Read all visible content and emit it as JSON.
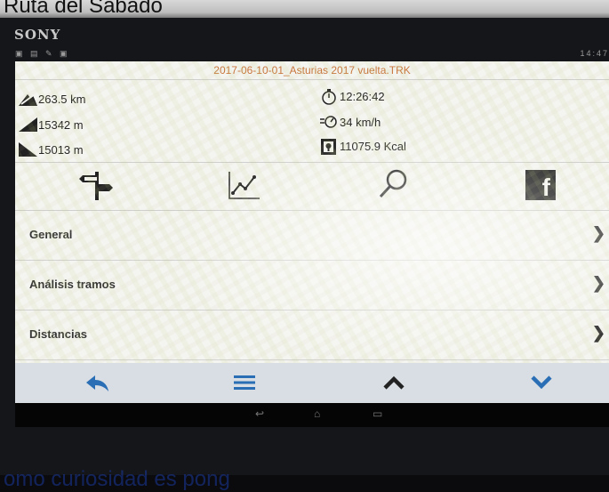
{
  "banner": {
    "text": "Ruta del Sábado"
  },
  "device": {
    "brand": "SONY"
  },
  "statusbar": {
    "left_icons": "▣ ▤ ✎ ▣",
    "right_text": "14:47"
  },
  "app": {
    "file_title": "2017-06-10-01_Asturias 2017 vuelta.TRK",
    "stats": {
      "distance": "263.5 km",
      "ascent": "15342 m",
      "descent": "15013 m",
      "time": "12:26:42",
      "speed": "34 km/h",
      "energy": "11075.9 Kcal"
    },
    "toolbar_icons": [
      "signpost-icon",
      "chart-icon",
      "search-icon",
      "facebook-icon"
    ],
    "facebook_glyph": "f",
    "menu": [
      {
        "label": "General",
        "chevron": "❯"
      },
      {
        "label": "Análisis tramos",
        "chevron": "❯"
      },
      {
        "label": "Distancias",
        "chevron": "❯"
      }
    ],
    "bottom_bar": [
      "back-icon",
      "menu-icon",
      "up-icon",
      "down-icon"
    ],
    "accent": "#2a6fb5",
    "title_color": "#c8743a"
  },
  "system_nav": {
    "back": "↩",
    "home": "⌂",
    "recents": "▭"
  },
  "caption": {
    "text": "omo curiosidad es pong"
  }
}
